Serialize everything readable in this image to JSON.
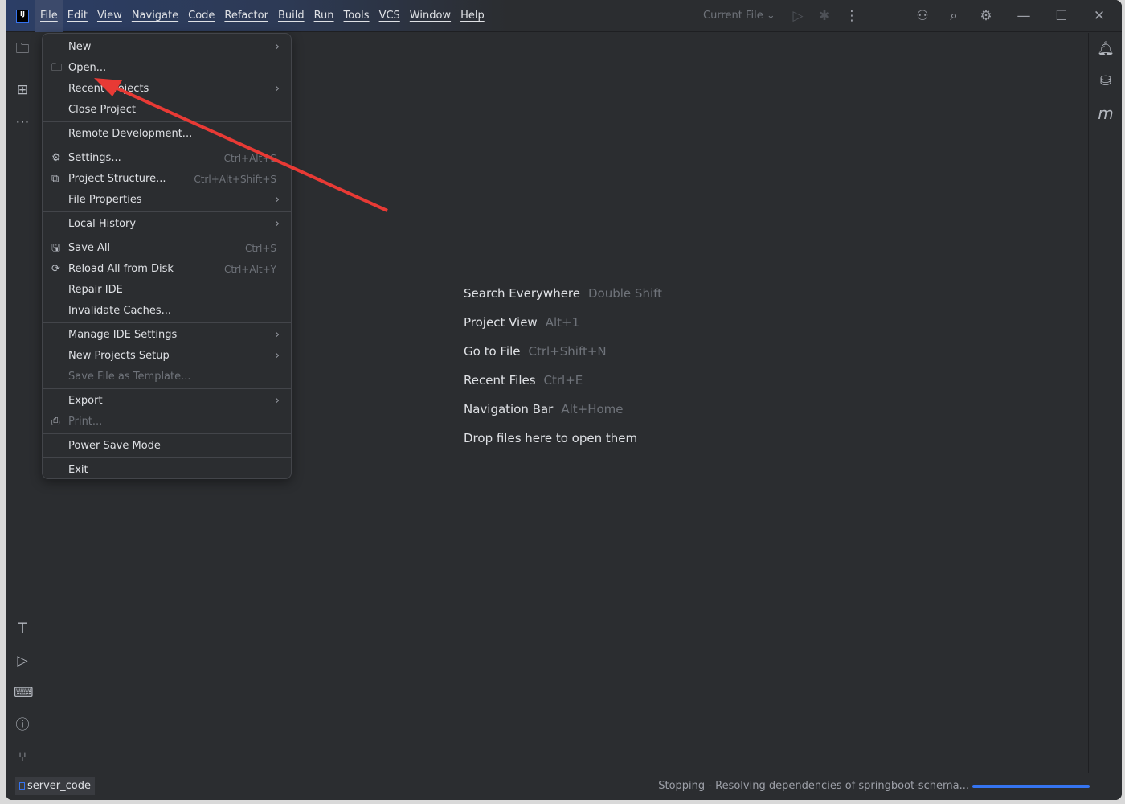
{
  "menubar": [
    "File",
    "Edit",
    "View",
    "Navigate",
    "Code",
    "Refactor",
    "Build",
    "Run",
    "Tools",
    "VCS",
    "Window",
    "Help"
  ],
  "toolbar": {
    "run_config": "Current File"
  },
  "file_menu": [
    {
      "label": "New",
      "arrow": true
    },
    {
      "label": "Open...",
      "icon": "folder-icon"
    },
    {
      "label": "Recent Projects",
      "arrow": true
    },
    {
      "label": "Close Project",
      "sep_after": true
    },
    {
      "label": "Remote Development...",
      "sep_after": true
    },
    {
      "label": "Settings...",
      "icon": "gear-icon",
      "shortcut": "Ctrl+Alt+S"
    },
    {
      "label": "Project Structure...",
      "icon": "project-structure-icon",
      "shortcut": "Ctrl+Alt+Shift+S"
    },
    {
      "label": "File Properties",
      "arrow": true,
      "sep_after": true
    },
    {
      "label": "Local History",
      "arrow": true,
      "sep_after": true
    },
    {
      "label": "Save All",
      "icon": "save-icon",
      "shortcut": "Ctrl+S"
    },
    {
      "label": "Reload All from Disk",
      "icon": "reload-icon",
      "shortcut": "Ctrl+Alt+Y"
    },
    {
      "label": "Repair IDE"
    },
    {
      "label": "Invalidate Caches...",
      "sep_after": true
    },
    {
      "label": "Manage IDE Settings",
      "arrow": true
    },
    {
      "label": "New Projects Setup",
      "arrow": true
    },
    {
      "label": "Save File as Template...",
      "disabled": true,
      "sep_after": true
    },
    {
      "label": "Export",
      "arrow": true
    },
    {
      "label": "Print...",
      "icon": "print-icon",
      "disabled": true,
      "sep_after": true
    },
    {
      "label": "Power Save Mode",
      "sep_after": true
    },
    {
      "label": "Exit"
    }
  ],
  "hints": [
    {
      "text": "Search Everywhere",
      "key": "Double Shift"
    },
    {
      "text": "Project View",
      "key": "Alt+1"
    },
    {
      "text": "Go to File",
      "key": "Ctrl+Shift+N"
    },
    {
      "text": "Recent Files",
      "key": "Ctrl+E"
    },
    {
      "text": "Navigation Bar",
      "key": "Alt+Home"
    },
    {
      "text": "Drop files here to open them",
      "key": ""
    }
  ],
  "statusbar": {
    "project": "server_code",
    "message": "Stopping - Resolving dependencies of springboot-schema...",
    "progress": 1.0
  },
  "colors": {
    "accent": "#3574f0",
    "annotation_arrow": "#e83a35"
  }
}
